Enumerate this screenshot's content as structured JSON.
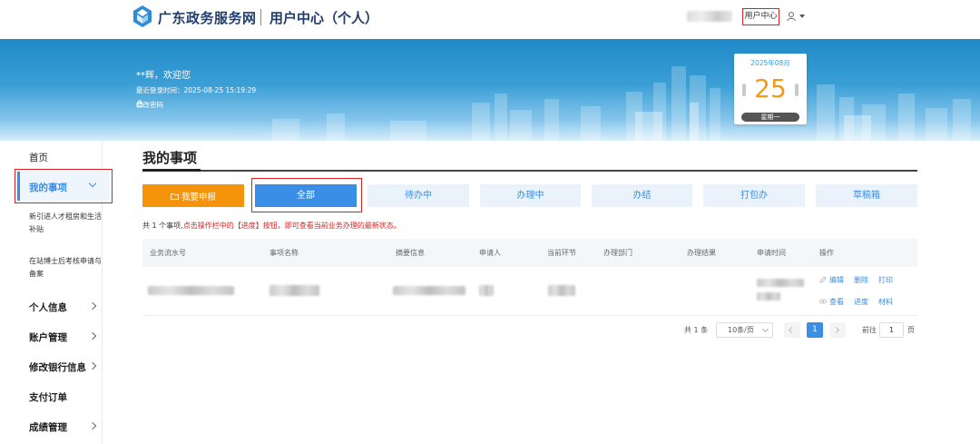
{
  "header": {
    "site_name": "广东政务服务网",
    "center_name": "用户中心（个人）",
    "user_center_link": "用户中心"
  },
  "banner": {
    "welcome": "**辉，欢迎您",
    "last_login": "最近登录时间：2025-08-25 15:19:29",
    "change_password": "修改密码",
    "calendar": {
      "month": "2025年08月",
      "day": "25",
      "weekday": "星期一"
    }
  },
  "sidebar": {
    "home": "首页",
    "my_items": "我的事项",
    "sub_items": [
      "新引进人才租房和生活补贴",
      "在站博士后考核申请与备案"
    ],
    "personal_info": "个人信息",
    "account": "账户管理",
    "bank_info": "修改银行信息",
    "orders": "支付订单",
    "grades": "成绩管理"
  },
  "main": {
    "title": "我的事项",
    "apply_button": "我要申报",
    "tabs": [
      "全部",
      "待办中",
      "办理中",
      "办结",
      "打包办",
      "草稿箱"
    ],
    "active_tab": "全部",
    "notice_prefix": "共 1 个事项,",
    "notice_red": "点击操作栏中的【进度】按钮，即可查看当前业务办理的最新状态。",
    "table": {
      "headers": [
        "业务流水号",
        "事项名称",
        "摘要信息",
        "申请人",
        "当前环节",
        "办理部门",
        "办理结果",
        "申请时间",
        "操作"
      ],
      "row_ops": [
        "编辑",
        "删除",
        "打印",
        "查看",
        "进度",
        "材料"
      ]
    },
    "pagination": {
      "total": "共 1 条",
      "page_size": "10条/页",
      "current_page": "1",
      "goto_label": "前往",
      "goto_value": "1",
      "page_suffix": "页"
    }
  },
  "colors": {
    "accent": "#3a8ee6",
    "orange": "#f5930a",
    "highlight_red": "#e02020"
  }
}
